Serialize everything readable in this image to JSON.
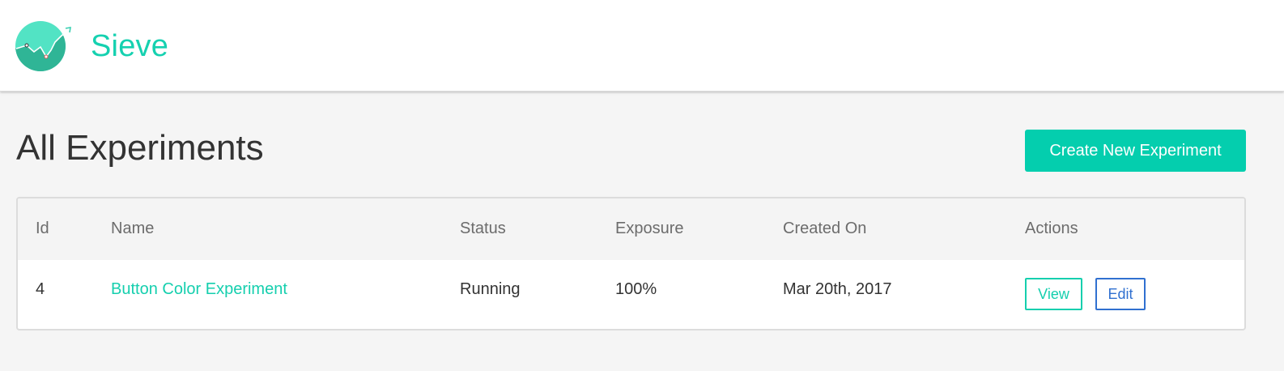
{
  "header": {
    "brand_name": "Sieve",
    "logo_icon": "trending-chart-logo",
    "accent_color": "#15d1b0"
  },
  "page": {
    "title": "All Experiments",
    "create_button_label": "Create New Experiment"
  },
  "table": {
    "columns": [
      "Id",
      "Name",
      "Status",
      "Exposure",
      "Created On",
      "Actions"
    ],
    "rows": [
      {
        "id": "4",
        "name": "Button Color Experiment",
        "status": "Running",
        "exposure": "100%",
        "created_on": "Mar 20th, 2017",
        "view_label": "View",
        "edit_label": "Edit"
      }
    ]
  }
}
